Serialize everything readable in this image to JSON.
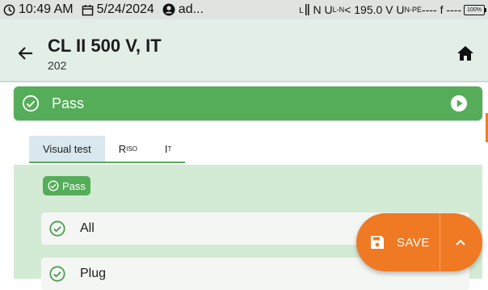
{
  "status_bar": {
    "time": "10:49 AM",
    "date": "5/24/2024",
    "user": "ad...",
    "measurement": "N U",
    "measurement_sub": "L-N",
    "measurement_value": " < 195.0 V U",
    "measurement_sub2": "N-PE",
    "measurement_tail": " ---- f ----",
    "battery": "100%"
  },
  "header": {
    "title": "CL II 500 V, IT",
    "subtitle": "202"
  },
  "result_banner": {
    "label": "Pass",
    "color": "#55ad59"
  },
  "tabs": [
    {
      "label": "Visual test",
      "active": true
    },
    {
      "label": "R",
      "sub": "ISO",
      "active": false
    },
    {
      "label": "I",
      "sub": "T",
      "active": false
    }
  ],
  "visual_test": {
    "status_chip": "Pass",
    "items": [
      {
        "label": "All"
      },
      {
        "label": "Plug"
      }
    ]
  },
  "fab": {
    "save_label": "SAVE",
    "color": "#ef7a23"
  }
}
